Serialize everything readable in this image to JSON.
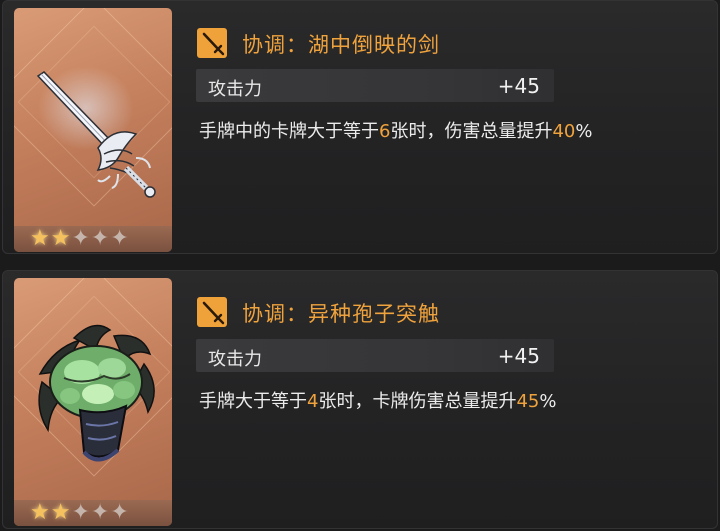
{
  "items": [
    {
      "weapon_icon": "silver-sword-icon",
      "stars_filled": 2,
      "stars_total": 5,
      "title": "协调：湖中倒映的剑",
      "stat_label": "攻击力",
      "stat_value": "+45",
      "desc_1": "手牌中的卡牌大于等于",
      "desc_n1": "6",
      "desc_2": "张时，伤害总量提升",
      "desc_n2": "40",
      "desc_3": "%"
    },
    {
      "weapon_icon": "spore-tentacle-gauntlet-icon",
      "stars_filled": 2,
      "stars_total": 5,
      "title": "协调：异种孢子突触",
      "stat_label": "攻击力",
      "stat_value": "+45",
      "desc_1": "手牌大于等于",
      "desc_n1": "4",
      "desc_2": "张时，卡牌伤害总量提升",
      "desc_n2": "45",
      "desc_3": "%"
    }
  ],
  "colors": {
    "accent": "#f0a33c",
    "star_on": "#f4c15e",
    "star_off": "#cfc3bd",
    "thumb_bg": "#c47f5c"
  }
}
